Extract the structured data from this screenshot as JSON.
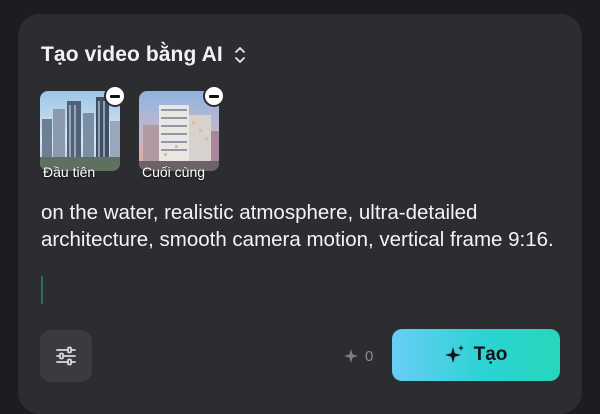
{
  "header": {
    "title": "Tạo video bằng AI",
    "selector_icon": "chevron-up-down-icon"
  },
  "frames": [
    {
      "label": "Đầu tiên",
      "remove_icon": "minus-circle-icon"
    },
    {
      "label": "Cuối cùng",
      "remove_icon": "minus-circle-icon"
    }
  ],
  "prompt": {
    "text": "on the water, realistic atmosphere, ultra-detailed architecture, smooth camera motion, vertical frame 9:16."
  },
  "toolbar": {
    "settings_icon": "sliders-icon",
    "credits_icon": "sparkle-icon",
    "credits_value": "0",
    "generate_label": "Tạo",
    "generate_icon": "sparkles-icon"
  },
  "colors": {
    "background": "#1c1d20",
    "card": "#2c2d31",
    "accent_gradient_start": "#69cdf7",
    "accent_gradient_end": "#28d6bb"
  }
}
